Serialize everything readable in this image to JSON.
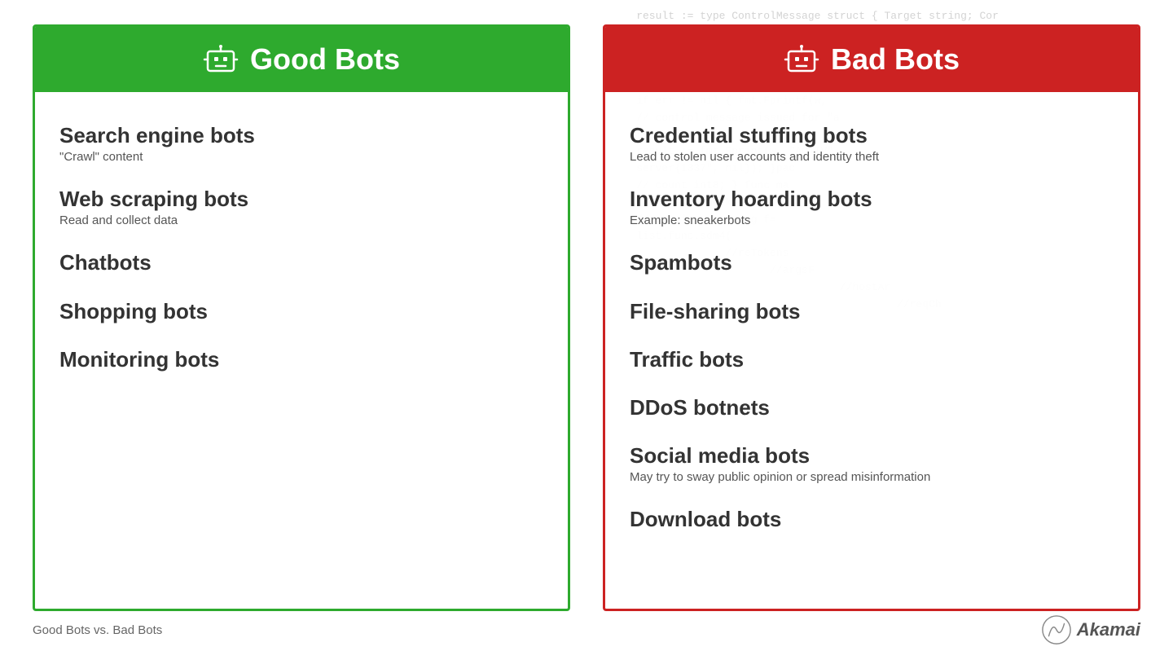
{
  "background_code": "    result := type ControlMessage struct { Target string; Cor\n    channel := make(chan chan bool); v\n                                                              case\n                                                          utus\n    handler := func(w *http.Request) { hostPol\n    if err != nil { fmt.Fprintf(w,\n    // control message issued for \"a\n    reqChan\n    result := fmt.Fprint(w, \"ACTIV\"\n    server{1337\", nil}); }pac\n    // count int8; } func ma\n    bot.bool): workerFu\n    // session case msg f=\n    list.func.sdm4(\n                  //reTokens\n                         //argsF\n                                    //hostAr\n                                             //reqCh",
  "good_bots": {
    "header": {
      "title": "Good Bots",
      "icon_label": "bot-icon"
    },
    "items": [
      {
        "title": "Search engine bots",
        "subtitle": "\"Crawl\" content"
      },
      {
        "title": "Web scraping bots",
        "subtitle": "Read and collect data"
      },
      {
        "title": "Chatbots",
        "subtitle": ""
      },
      {
        "title": "Shopping bots",
        "subtitle": ""
      },
      {
        "title": "Monitoring bots",
        "subtitle": ""
      }
    ]
  },
  "bad_bots": {
    "header": {
      "title": "Bad Bots",
      "icon_label": "bot-icon"
    },
    "items": [
      {
        "title": "Credential stuffing bots",
        "subtitle": "Lead to stolen user accounts and identity theft"
      },
      {
        "title": "Inventory hoarding bots",
        "subtitle": "Example: sneakerbots"
      },
      {
        "title": "Spambots",
        "subtitle": ""
      },
      {
        "title": "File-sharing bots",
        "subtitle": ""
      },
      {
        "title": "Traffic bots",
        "subtitle": ""
      },
      {
        "title": "DDoS botnets",
        "subtitle": ""
      },
      {
        "title": "Social media bots",
        "subtitle": "May try to sway public opinion or spread misinformation"
      },
      {
        "title": "Download bots",
        "subtitle": ""
      }
    ]
  },
  "footer": {
    "label": "Good Bots vs. Bad Bots",
    "brand": "Akamai"
  },
  "colors": {
    "good": "#2eaa2e",
    "bad": "#cc2222"
  }
}
